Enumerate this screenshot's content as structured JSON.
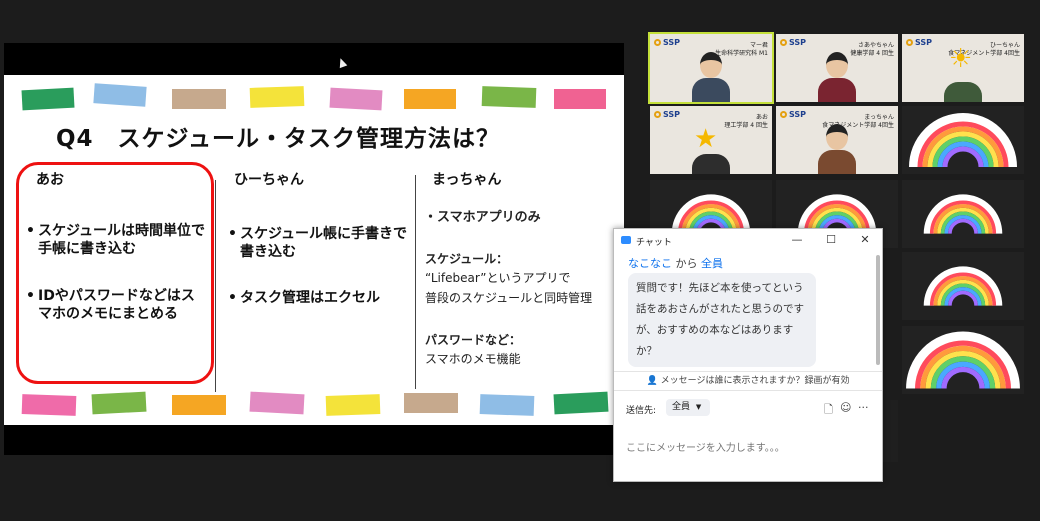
{
  "slide": {
    "title": "Q4　スケジュール・タスク管理方法は？",
    "tape_colors": [
      "#2a9d5c",
      "#8fbde6",
      "#c6a98d",
      "#f4e33a",
      "#e28bc2",
      "#f5a623",
      "#7ab648",
      "#f06292"
    ],
    "tape_colors_bottom": [
      "#ef6ba9",
      "#7ab648",
      "#f5a623",
      "#e28bc2",
      "#f4e33a",
      "#c6a98d",
      "#8fbde6",
      "#2a9d5c"
    ],
    "col1": {
      "head": "あお",
      "b1": "スケジュールは時間単位で手帳に書き込む",
      "b2": "IDやパスワードなどはスマホのメモにまとめる"
    },
    "col2": {
      "head": "ひーちゃん",
      "b1": "スケジュール帳に手書きで書き込む",
      "b2": "タスク管理はエクセル"
    },
    "col3": {
      "head": "まっちゃん",
      "b1": "・スマホアプリのみ",
      "sched_label": "スケジュール：",
      "sched_line1": "“Lifebear”というアプリで",
      "sched_line2": "普段のスケジュールと同時管理",
      "pw_label": "パスワードなど：",
      "pw_value": "スマホのメモ機能"
    },
    "bullet_symbol": "•"
  },
  "tiles": [
    {
      "name": "マー君",
      "sub": "生命科学研究科 M1",
      "org": "SSP"
    },
    {
      "name": "さあやちゃん",
      "sub": "健康学部 4 回生",
      "org": "SSP"
    },
    {
      "name": "ひーちゃん",
      "sub": "食マネジメント学部 4回生",
      "org": "SSP"
    },
    {
      "name": "あお",
      "sub": "理工学部 4 回生",
      "org": "SSP"
    },
    {
      "name": "まっちゃん",
      "sub": "食マネジメント学部 4回生",
      "org": "SSP"
    }
  ],
  "chat": {
    "title": "チャット",
    "from_user": "なこなこ",
    "from_mid": " から ",
    "to_user": "全員",
    "message": "質問です！先ほど本を使ってという話をあおさんがされたと思うのですが、おすすめの本などはありますか？",
    "notice": "メッセージは誰に表示されますか？録画が有効",
    "send_to_label": "送信先:",
    "send_to_value": "全員",
    "input_placeholder": "ここにメッセージを入力します。。。",
    "accent": "#0e72ed"
  }
}
